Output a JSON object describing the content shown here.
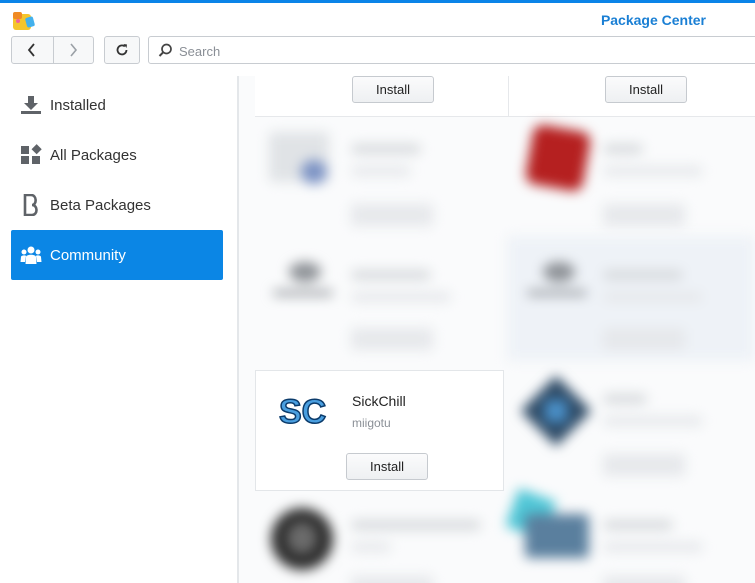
{
  "window": {
    "title": "Package Center"
  },
  "toolbar": {
    "search_placeholder": "Search"
  },
  "sidebar": {
    "items": [
      {
        "label": "Installed",
        "icon": "download-icon"
      },
      {
        "label": "All Packages",
        "icon": "grid-icon"
      },
      {
        "label": "Beta Packages",
        "icon": "beta-icon"
      },
      {
        "label": "Community",
        "icon": "community-icon",
        "active": true
      }
    ]
  },
  "packages": {
    "top_row": [
      {
        "button_label": "Install"
      },
      {
        "button_label": "Install"
      }
    ],
    "featured": {
      "name": "SickChill",
      "author": "miigotu",
      "button_label": "Install"
    }
  },
  "colors": {
    "accent": "#0b86e5",
    "title": "#1a7fd4"
  }
}
